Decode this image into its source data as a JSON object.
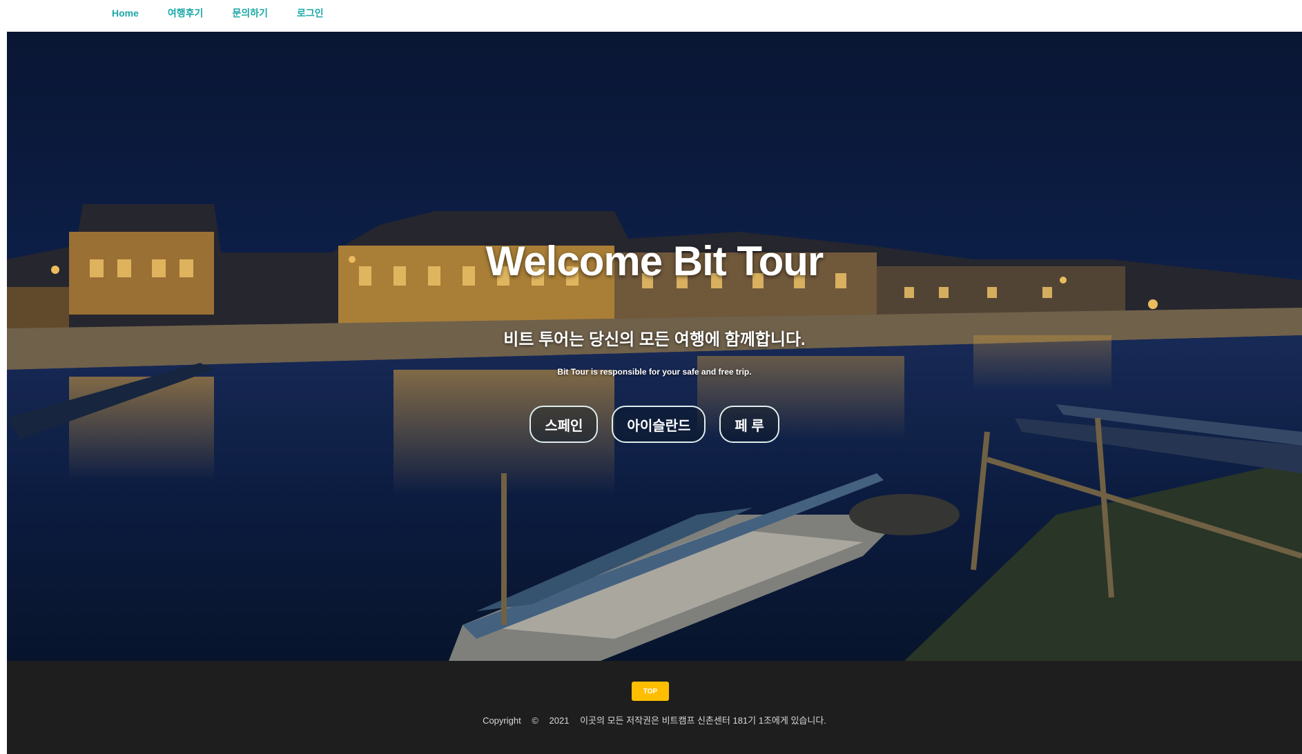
{
  "nav": {
    "items": [
      {
        "label": "Home"
      },
      {
        "label": "여행후기"
      },
      {
        "label": "문의하기"
      },
      {
        "label": "로그인"
      }
    ],
    "link_color": "#1ba8a8"
  },
  "hero": {
    "title": "Welcome Bit Tour",
    "subtitle": "비트 투어는 당신의 모든 여행에 함께합니다.",
    "tagline": "Bit Tour is responsible for your safe and free trip.",
    "buttons": [
      {
        "label": "스페인"
      },
      {
        "label": "아이슬란드"
      },
      {
        "label": "페 루"
      }
    ]
  },
  "footer": {
    "top_button_label": "TOP",
    "top_button_color": "#ffbe00",
    "copyright_label": "Copyright",
    "copyright_symbol": "©",
    "year": "2021",
    "notice": "이곳의 모든 저작권은 비트캠프 신촌센터 181기 1조에게 있습니다."
  }
}
